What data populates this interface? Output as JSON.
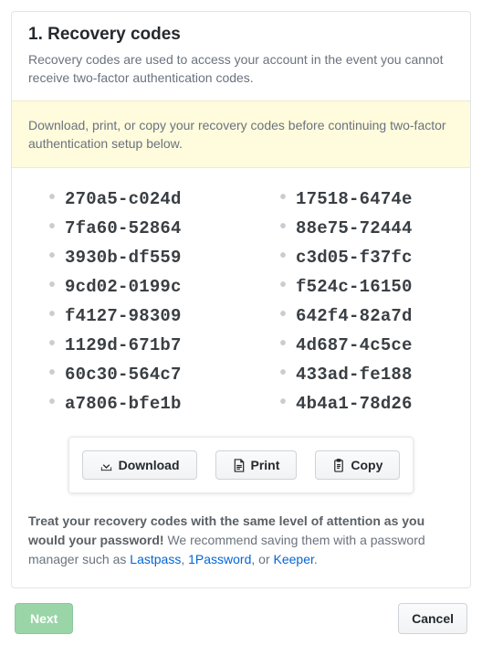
{
  "section": {
    "title": "1. Recovery codes",
    "description": "Recovery codes are used to access your account in the event you cannot receive two-factor authentication codes."
  },
  "notice": "Download, print, or copy your recovery codes before continuing two-factor authentication setup below.",
  "codes": {
    "left": [
      "270a5-c024d",
      "7fa60-52864",
      "3930b-df559",
      "9cd02-0199c",
      "f4127-98309",
      "1129d-671b7",
      "60c30-564c7",
      "a7806-bfe1b"
    ],
    "right": [
      "17518-6474e",
      "88e75-72444",
      "c3d05-f37fc",
      "f524c-16150",
      "642f4-82a7d",
      "4d687-4c5ce",
      "433ad-fe188",
      "4b4a1-78d26"
    ]
  },
  "buttons": {
    "download": "Download",
    "print": "Print",
    "copy": "Copy"
  },
  "warning": {
    "strong": "Treat your recovery codes with the same level of attention as you would your password!",
    "rest1": " We recommend saving them with a password manager such as ",
    "link1": "Lastpass",
    "sep1": ", ",
    "link2": "1Password",
    "sep2": ", or ",
    "link3": "Keeper",
    "end": "."
  },
  "footer": {
    "next": "Next",
    "cancel": "Cancel"
  }
}
